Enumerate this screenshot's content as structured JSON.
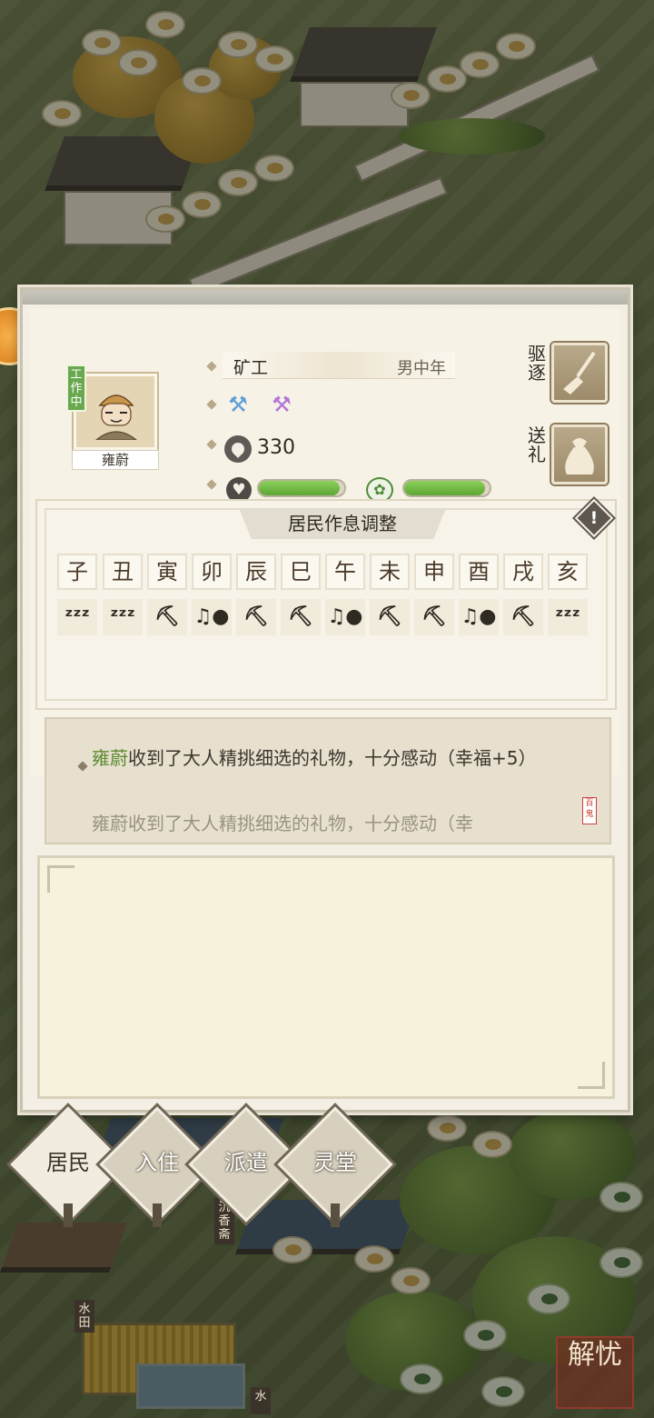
{
  "character": {
    "status_badge": "工作中",
    "name": "雍蔚",
    "job": "矿工",
    "gender_age": "男中年",
    "coins": "330",
    "health_ratio": 0.95,
    "happiness_ratio": 0.95
  },
  "actions": {
    "expel_label": "驱逐",
    "gift_label": "送礼"
  },
  "schedule": {
    "title": "居民作息调整",
    "hours": [
      "子",
      "丑",
      "寅",
      "卯",
      "辰",
      "巳",
      "午",
      "未",
      "申",
      "酉",
      "戌",
      "亥"
    ],
    "activities": [
      "sleep",
      "sleep",
      "work",
      "rest",
      "work",
      "work",
      "rest",
      "work",
      "work",
      "rest",
      "work",
      "sleep"
    ]
  },
  "log": {
    "entry1_name": "雍蔚",
    "entry1_text": "收到了大人精挑细选的礼物，十分感动（幸福+5）",
    "entry2_text": "雍蔚收到了大人精挑细选的礼物，十分感动（幸",
    "seal": "百鬼"
  },
  "nav": {
    "residents": "居民",
    "move_in": "入住",
    "dispatch": "派遣",
    "spirit_hall": "灵堂"
  },
  "map_signs": {
    "shop": "沉香斋",
    "paddy": "水田",
    "water": "水"
  },
  "corner_seal": "解忧",
  "colors": {
    "accent_green": "#6aa84f",
    "panel_bg": "#f3efe4",
    "name_highlight": "#5b8a2f"
  }
}
